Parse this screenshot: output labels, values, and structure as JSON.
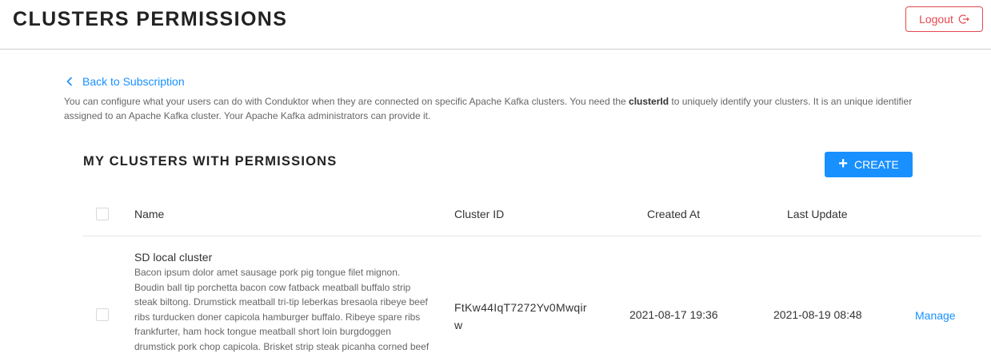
{
  "header": {
    "title": "CLUSTERS PERMISSIONS",
    "logout_label": "Logout"
  },
  "back_link": {
    "label": "Back to Subscription"
  },
  "intro": {
    "part1": "You can configure what your users can do with Conduktor when they are connected on specific Apache Kafka clusters. You need the ",
    "bold": "clusterId",
    "part2": " to uniquely identify your clusters. It is an unique identifier assigned to an Apache Kafka cluster. Your Apache Kafka administrators can provide it."
  },
  "section": {
    "title": "MY CLUSTERS WITH PERMISSIONS",
    "create_label": "CREATE"
  },
  "table": {
    "columns": [
      "Name",
      "Cluster ID",
      "Created At",
      "Last Update"
    ],
    "rows": [
      {
        "name": "SD local cluster",
        "description": "Bacon ipsum dolor amet sausage pork pig tongue filet mignon. Boudin ball tip porchetta bacon cow fatback meatball buffalo strip steak biltong. Drumstick meatball tri-tip leberkas bresaola ribeye beef ribs turducken doner capicola hamburger buffalo. Ribeye spare ribs frankfurter, ham hock tongue meatball short loin burgdoggen drumstick pork chop capicola. Brisket strip steak picanha corned beef flank landjaeger sirloin pastrami",
        "cluster_id": "FtKw44IqT7272Yv0Mwqirw",
        "created_at": "2021-08-17 19:36",
        "last_update": "2021-08-19 08:48",
        "action_label": "Manage"
      }
    ]
  },
  "colors": {
    "accent": "#1890ff",
    "danger": "#e5484d"
  },
  "icons": {
    "logout": "logout-icon",
    "back": "chevron-left-icon",
    "create": "plus-icon"
  }
}
